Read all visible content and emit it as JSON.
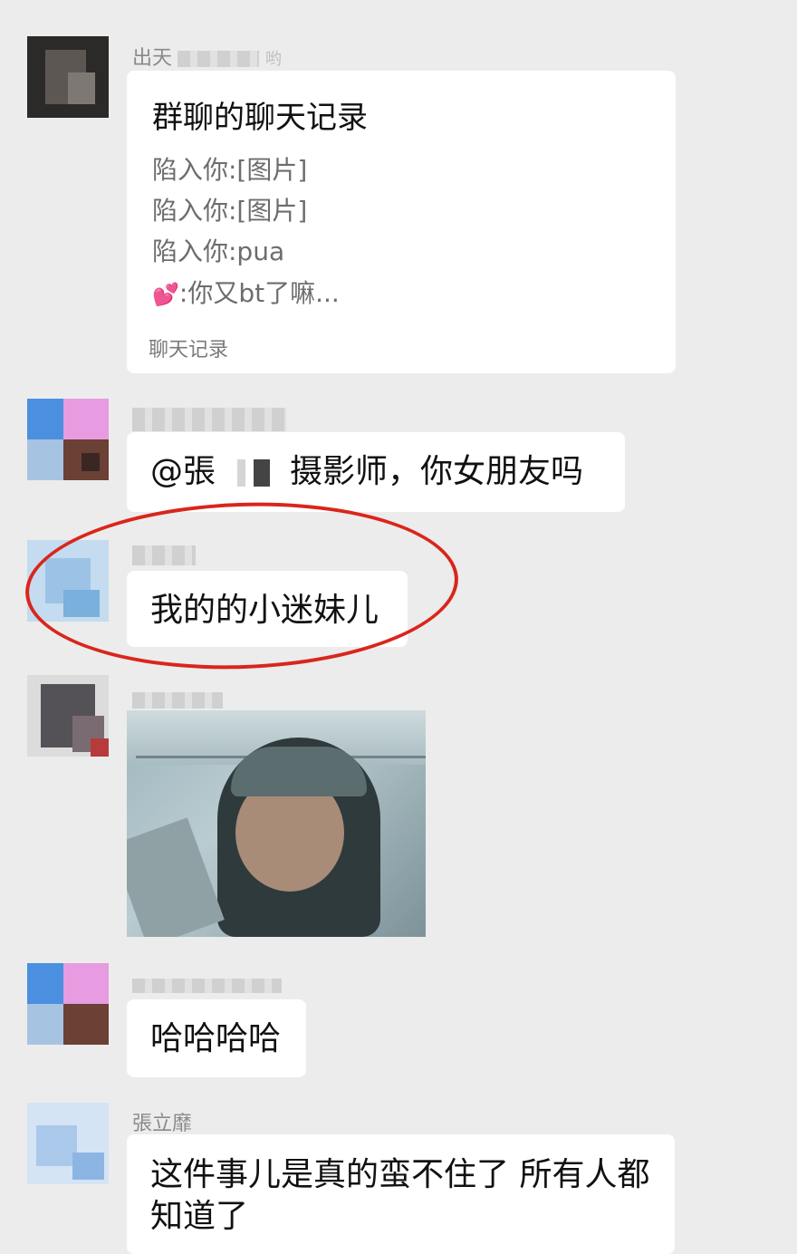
{
  "messages": {
    "m1": {
      "sender": "出天",
      "sender_suffix": "哟",
      "card": {
        "title": "群聊的聊天记录",
        "lines": [
          "陷入你:[图片]",
          "陷入你:[图片]",
          "陷入你:pua",
          ":你又bt了嘛..."
        ],
        "footer": "聊天记录"
      }
    },
    "m2": {
      "text_prefix": "@張",
      "text_suffix": "摄影师，你女朋友吗"
    },
    "m3": {
      "text": "我的的小迷妹儿"
    },
    "m4": {
      "image": "meme-photo"
    },
    "m5": {
      "text": "哈哈哈哈"
    },
    "m6": {
      "sender": "張立靡",
      "text_line1": "这件事儿是真的蛮不住了 所有人都",
      "text_line2": "知道了"
    }
  },
  "colors": {
    "highlight_circle": "#d9261c",
    "background": "#ececec",
    "bubble": "#ffffff"
  }
}
